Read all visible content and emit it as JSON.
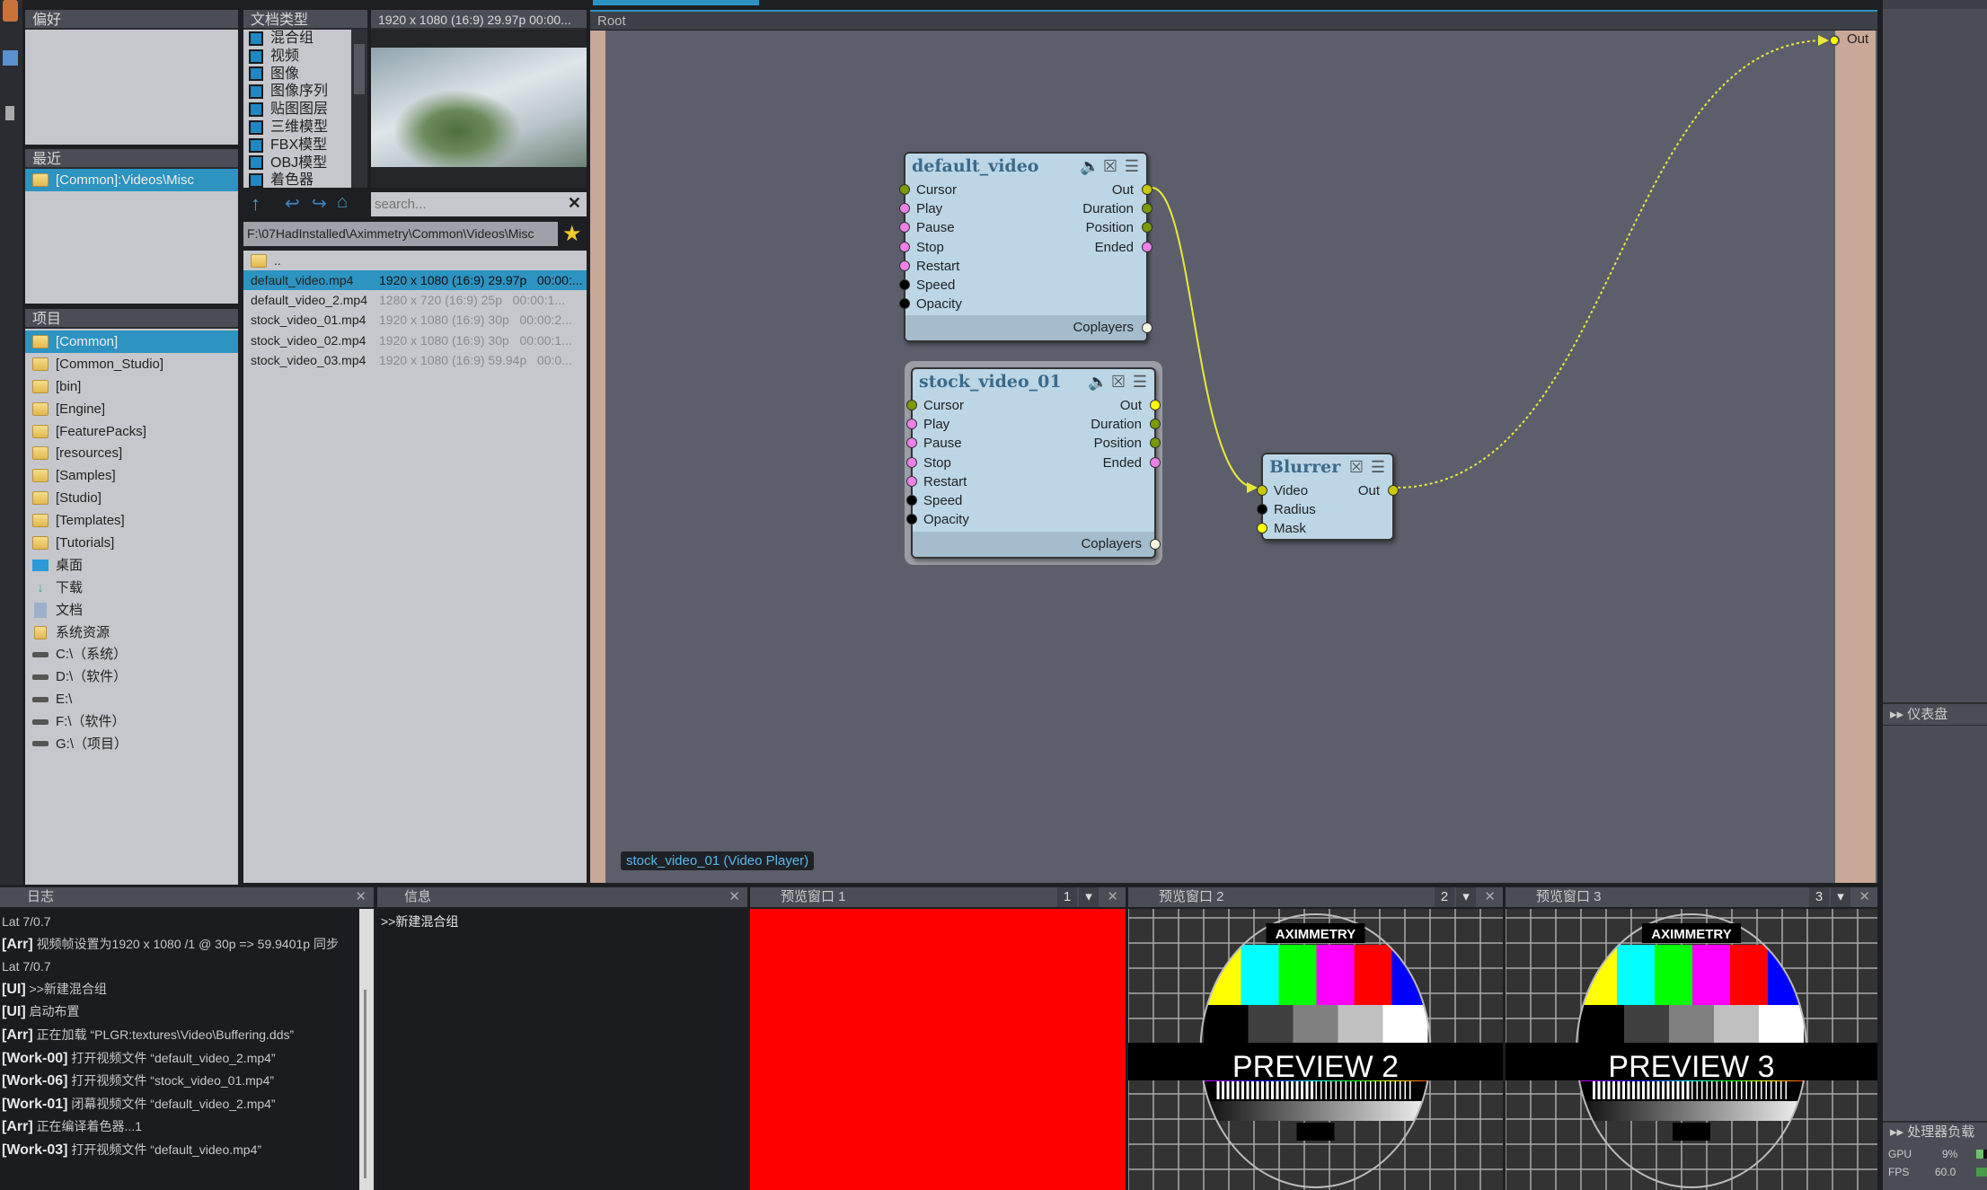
{
  "left": {
    "fav_title": "偏好",
    "recent_title": "最近",
    "recent_items": [
      "[Common]:Videos\\Misc"
    ],
    "project_title": "项目",
    "projects": [
      {
        "label": "[Common]",
        "type": "folder"
      },
      {
        "label": "[Common_Studio]",
        "type": "folder"
      },
      {
        "label": "[bin]",
        "type": "folder"
      },
      {
        "label": "[Engine]",
        "type": "folder"
      },
      {
        "label": "[FeaturePacks]",
        "type": "folder"
      },
      {
        "label": "[resources]",
        "type": "folder"
      },
      {
        "label": "[Samples]",
        "type": "folder"
      },
      {
        "label": "[Studio]",
        "type": "folder"
      },
      {
        "label": "[Templates]",
        "type": "folder"
      },
      {
        "label": "[Tutorials]",
        "type": "folder"
      },
      {
        "label": "桌面",
        "type": "desktop"
      },
      {
        "label": "下载",
        "type": "download"
      },
      {
        "label": "文档",
        "type": "document"
      },
      {
        "label": "系统资源",
        "type": "zip"
      },
      {
        "label": "C:\\（系统）",
        "type": "drive"
      },
      {
        "label": "D:\\（软件）",
        "type": "drive"
      },
      {
        "label": "E:\\",
        "type": "drive"
      },
      {
        "label": "F:\\（软件）",
        "type": "drive"
      },
      {
        "label": "G:\\（项目）",
        "type": "drive"
      }
    ]
  },
  "doctypes": {
    "title": "文档类型",
    "items": [
      "混合组",
      "视频",
      "图像",
      "图像序列",
      "贴图图层",
      "三维模型",
      "FBX模型",
      "OBJ模型",
      "着色器"
    ]
  },
  "thumb": {
    "info": "1920 x 1080 (16:9) 29.97p   00:00..."
  },
  "browser": {
    "search_placeholder": "search...",
    "path": "F:\\07HadInstalled\\Aximmetry\\Common\\Videos\\Misc",
    "parent": "..",
    "files": [
      {
        "name": "default_video.mp4",
        "info": "1920 x 1080 (16:9) 29.97p   00:00:..."
      },
      {
        "name": "default_video_2.mp4",
        "info": "1280 x 720 (16:9) 25p   00:00:1..."
      },
      {
        "name": "stock_video_01.mp4",
        "info": "1920 x 1080 (16:9) 30p   00:00:2..."
      },
      {
        "name": "stock_video_02.mp4",
        "info": "1920 x 1080 (16:9) 30p   00:00:1..."
      },
      {
        "name": "stock_video_03.mp4",
        "info": "1920 x 1080 (16:9) 59.94p   00:0..."
      }
    ],
    "selected": 0
  },
  "graph": {
    "breadcrumb": "Root",
    "out_label": "Out",
    "status": "stock_video_01 (Video Player)",
    "video_inputs": [
      "Cursor",
      "Play",
      "Pause",
      "Stop",
      "Restart",
      "Speed",
      "Opacity"
    ],
    "video_outputs": [
      "Out",
      "Duration",
      "Position",
      "Ended"
    ],
    "coplayers": "Coplayers",
    "nodes": {
      "a": "default_video",
      "b": "stock_video_01",
      "c": "Blurrer"
    },
    "blur_inputs": [
      "Video",
      "Radius",
      "Mask"
    ],
    "blur_out": "Out"
  },
  "right": {
    "dashboard": "仪表盘",
    "cpu_title": "处理器负载",
    "gpu_label": "GPU",
    "gpu_value": "9%",
    "gpu_percent": 9,
    "fps_label": "FPS",
    "fps_value": "60.0"
  },
  "log": {
    "title": "日志",
    "lines": [
      [
        "",
        "Lat 7/0.7"
      ],
      [
        "[Arr]",
        "视频帧设置为1920 x 1080 /1 @ 30p => 59.9401p 同步"
      ],
      [
        "",
        "Lat 7/0.7"
      ],
      [
        "[UI]",
        ">>新建混合组"
      ],
      [
        "[UI]",
        "启动布置"
      ],
      [
        "[Arr]",
        "正在加载 “PLGR:textures\\Video\\Buffering.dds”"
      ],
      [
        "[Work-00]",
        "打开视频文件 “default_video_2.mp4”"
      ],
      [
        "[Work-06]",
        "打开视频文件 “stock_video_01.mp4”"
      ],
      [
        "[Work-01]",
        "闭幕视频文件 “default_video_2.mp4”"
      ],
      [
        "[Arr]",
        "正在编译着色器...1"
      ],
      [
        "[Work-03]",
        "打开视频文件 “default_video.mp4”"
      ]
    ]
  },
  "info": {
    "title": "信息",
    "text": ">>新建混合组"
  },
  "previews": [
    {
      "title": "预览窗口 1",
      "num": "1"
    },
    {
      "title": "预览窗口 2",
      "num": "2",
      "card": "PREVIEW 2",
      "brand": "AXIMMETRY"
    },
    {
      "title": "预览窗口 3",
      "num": "3",
      "card": "PREVIEW 3",
      "brand": "AXIMMETRY"
    }
  ],
  "colors": {
    "accent": "#2d93c1",
    "wire": "#e8e83a",
    "preview1": "#ff0000",
    "pin_green": "#7a9a00",
    "pin_pink": "#ee80e8",
    "pin_yellow": "#ffff00"
  }
}
